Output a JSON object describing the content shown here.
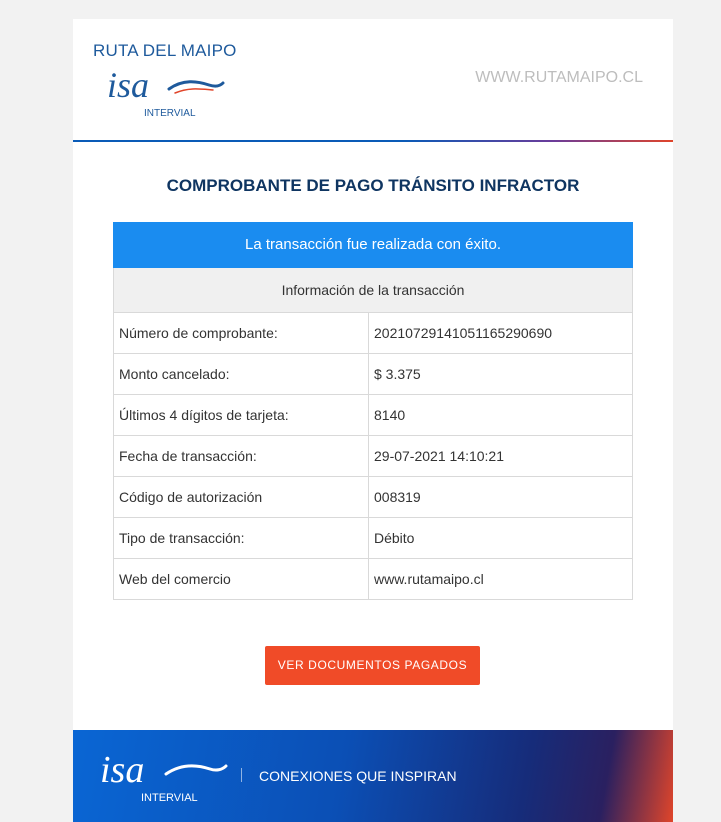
{
  "header": {
    "brand_name": "RUTA DEL MAIPO",
    "logo_icon": "isa-logo-icon",
    "logo_sub": "INTERVIAL",
    "site_url": "WWW.RUTAMAIPO.CL"
  },
  "title": "COMPROBANTE DE PAGO TRÁNSITO INFRACTOR",
  "transaction": {
    "success_message": "La transacción fue realizada con éxito.",
    "section_title": "Información de la transacción",
    "rows": [
      {
        "label": "Número de comprobante:",
        "value": "20210729141051165290690"
      },
      {
        "label": "Monto cancelado:",
        "value": "$ 3.375"
      },
      {
        "label": "Últimos 4 dígitos de tarjeta:",
        "value": "8140"
      },
      {
        "label": "Fecha de transacción:",
        "value": "29-07-2021 14:10:21"
      },
      {
        "label": "Código de autorización",
        "value": "008319"
      },
      {
        "label": "Tipo de transacción:",
        "value": "Débito"
      },
      {
        "label": "Web del comercio",
        "value": "www.rutamaipo.cl"
      }
    ]
  },
  "cta": {
    "label": "VER DOCUMENTOS PAGADOS"
  },
  "footer": {
    "logo_icon": "isa-logo-icon",
    "logo_sub": "INTERVIAL",
    "tagline": "CONEXIONES QUE INSPIRAN"
  },
  "colors": {
    "accent": "#1a8cf0",
    "title": "#0f3561",
    "button": "#f04b28",
    "brand_blue": "#1e5a9c"
  }
}
